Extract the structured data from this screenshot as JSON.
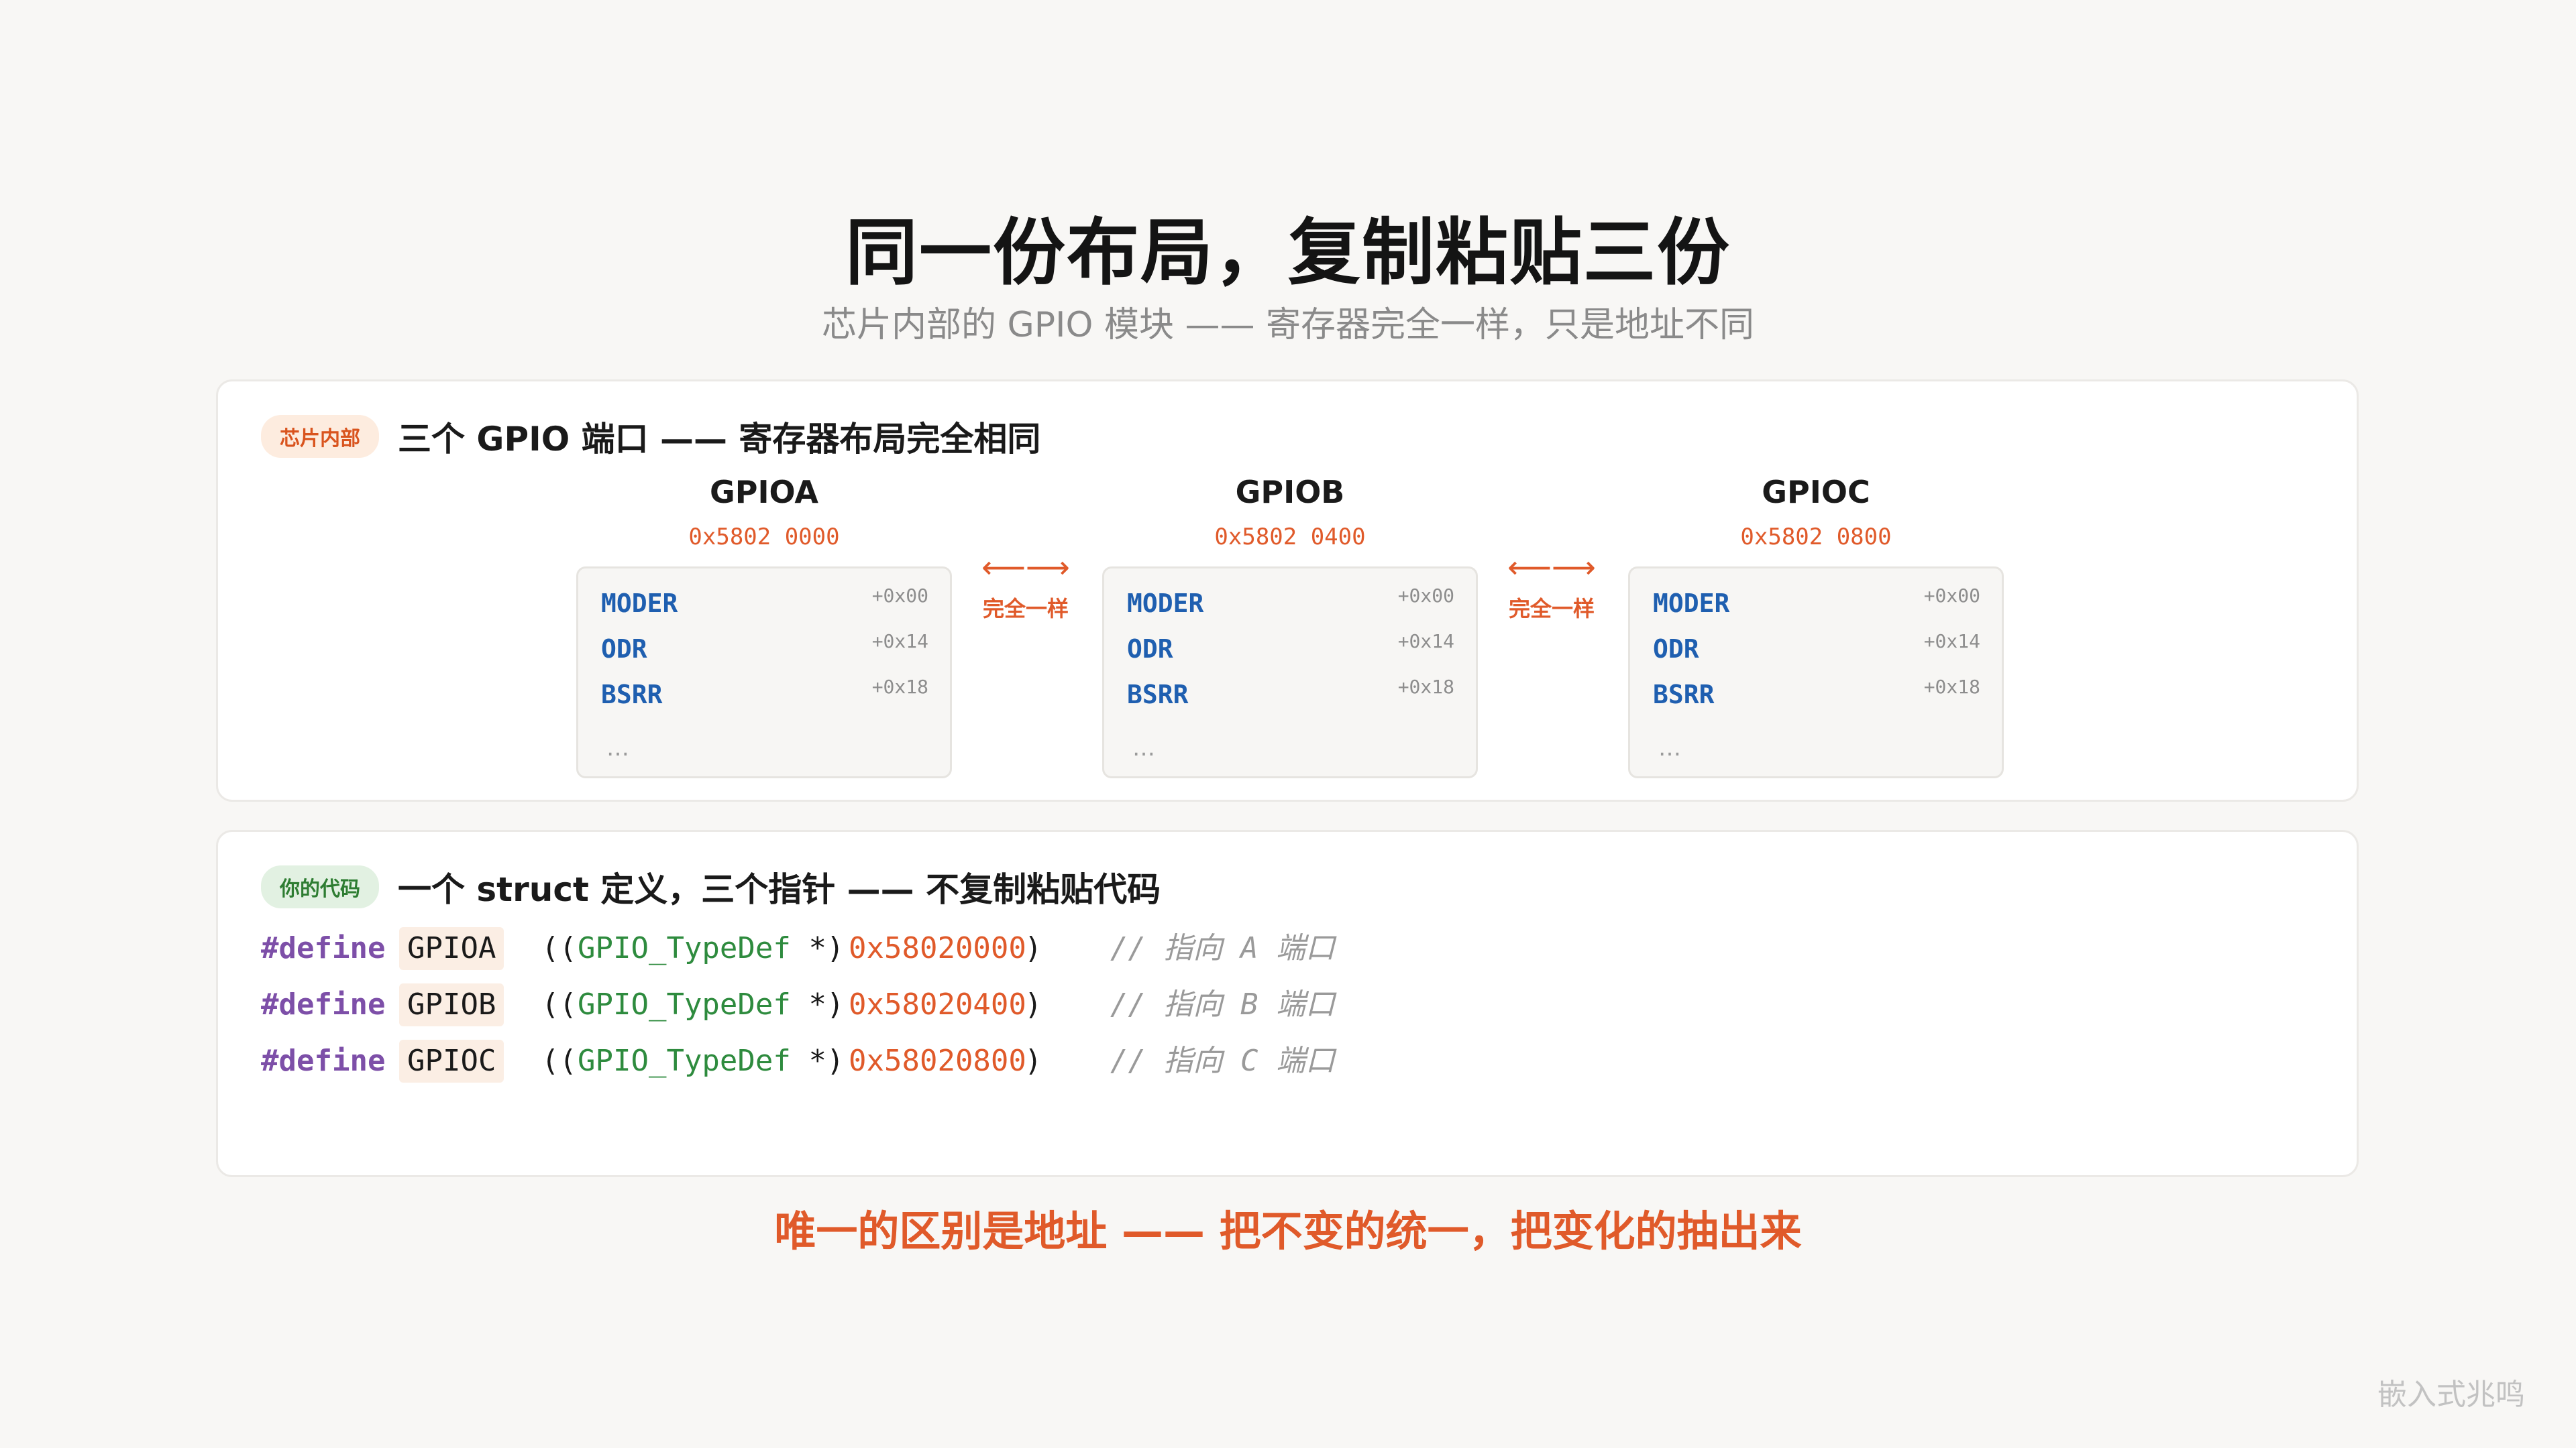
{
  "title": "同一份布局，复制粘贴三份",
  "subtitle": "芯片内部的 GPIO 模块 —— 寄存器完全一样，只是地址不同",
  "chip_section": {
    "tag": "芯片内部",
    "heading": "三个 GPIO 端口 —— 寄存器布局完全相同",
    "ports": [
      {
        "name": "GPIOA",
        "address": "0x5802 0000",
        "registers": [
          {
            "name": "MODER",
            "offset": "+0x00"
          },
          {
            "name": "ODR",
            "offset": "+0x14"
          },
          {
            "name": "BSRR",
            "offset": "+0x18"
          }
        ],
        "more": "…"
      },
      {
        "name": "GPIOB",
        "address": "0x5802 0400",
        "registers": [
          {
            "name": "MODER",
            "offset": "+0x00"
          },
          {
            "name": "ODR",
            "offset": "+0x14"
          },
          {
            "name": "BSRR",
            "offset": "+0x18"
          }
        ],
        "more": "…"
      },
      {
        "name": "GPIOC",
        "address": "0x5802 0800",
        "registers": [
          {
            "name": "MODER",
            "offset": "+0x00"
          },
          {
            "name": "ODR",
            "offset": "+0x14"
          },
          {
            "name": "BSRR",
            "offset": "+0x18"
          }
        ],
        "more": "…"
      }
    ],
    "connectors": [
      {
        "arrow": "⟵⟶",
        "label": "完全一样"
      },
      {
        "arrow": "⟵⟶",
        "label": "完全一样"
      }
    ]
  },
  "code_section": {
    "tag": "你的代码",
    "heading": "一个 struct 定义，三个指针 —— 不复制粘贴代码",
    "lines": [
      {
        "keyword": "#define",
        "macro": "GPIOA",
        "open": "((",
        "type": "GPIO_TypeDef",
        "star": " *)",
        "value": "0x58020000",
        "close": ")",
        "comment": "// 指向 A 端口"
      },
      {
        "keyword": "#define",
        "macro": "GPIOB",
        "open": "((",
        "type": "GPIO_TypeDef",
        "star": " *)",
        "value": "0x58020400",
        "close": ")",
        "comment": "// 指向 B 端口"
      },
      {
        "keyword": "#define",
        "macro": "GPIOC",
        "open": "((",
        "type": "GPIO_TypeDef",
        "star": " *)",
        "value": "0x58020800",
        "close": ")",
        "comment": "// 指向 C 端口"
      }
    ]
  },
  "conclusion": "唯一的区别是地址 —— 把不变的统一，把变化的抽出来",
  "watermark": "嵌入式兆鸣",
  "colors": {
    "accent": "#e05a2a",
    "register": "#1f5fb0",
    "keyword": "#7d4fa8",
    "type": "#2e8b3e",
    "comment": "#9a9a9a"
  }
}
